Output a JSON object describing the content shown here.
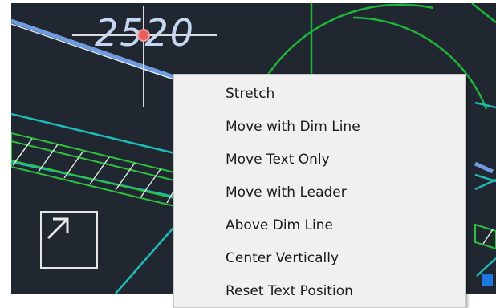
{
  "drawing": {
    "dimension_text": "2520",
    "colors": {
      "background": "#212731",
      "dimension_line": "#6f9be0",
      "wall_hatch": "#2fbf3f",
      "arc": "#1fb33a",
      "cyan_line": "#1fb9b8",
      "context_menu": "#f0f0f0"
    }
  },
  "view_cube": {
    "icon": "arrow-up-right-icon"
  },
  "context_menu": {
    "items": [
      {
        "label": "Stretch"
      },
      {
        "label": "Move with Dim Line"
      },
      {
        "label": "Move Text Only"
      },
      {
        "label": "Move with Leader"
      },
      {
        "label": "Above Dim Line"
      },
      {
        "label": "Center Vertically"
      },
      {
        "label": "Reset Text Position"
      }
    ]
  }
}
